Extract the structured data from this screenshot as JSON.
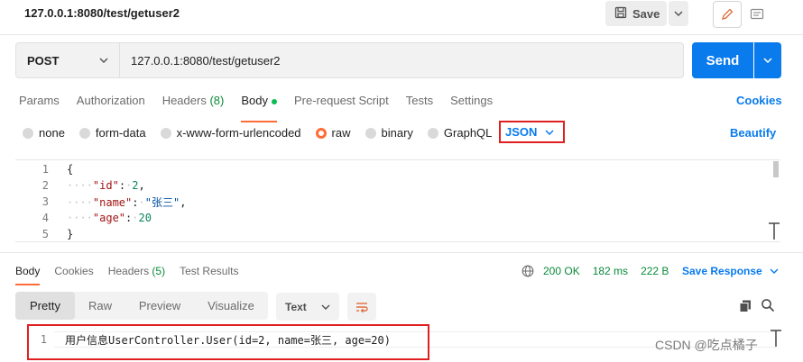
{
  "header": {
    "title": "127.0.0.1:8080/test/getuser2",
    "save_label": "Save"
  },
  "request": {
    "method": "POST",
    "url": "127.0.0.1:8080/test/getuser2",
    "send_label": "Send"
  },
  "tabs": {
    "params": "Params",
    "authorization": "Authorization",
    "headers": "Headers",
    "headers_count": "(8)",
    "body": "Body",
    "prerequest": "Pre-request Script",
    "tests": "Tests",
    "settings": "Settings",
    "cookies": "Cookies"
  },
  "body_types": {
    "none": "none",
    "form_data": "form-data",
    "urlencoded": "x-www-form-urlencoded",
    "raw": "raw",
    "binary": "binary",
    "graphql": "GraphQL",
    "selected": "raw",
    "language": "JSON",
    "beautify": "Beautify"
  },
  "editor": {
    "line_numbers": [
      "1",
      "2",
      "3",
      "4",
      "5"
    ],
    "open_brace": "{",
    "close_brace": "}",
    "indent": "····",
    "key_id": "\"id\"",
    "val_id": "2",
    "key_name": "\"name\"",
    "val_name": "\"张三\"",
    "key_age": "\"age\"",
    "val_age": "20",
    "colon": ":",
    "sep": "·",
    "comma": ","
  },
  "response_tabs": {
    "body": "Body",
    "cookies": "Cookies",
    "headers": "Headers",
    "headers_count": "(5)",
    "test_results": "Test Results"
  },
  "response_meta": {
    "status": "200 OK",
    "time": "182 ms",
    "size": "222 B",
    "save_response": "Save Response"
  },
  "view": {
    "pretty": "Pretty",
    "raw": "Raw",
    "preview": "Preview",
    "visualize": "Visualize",
    "format": "Text"
  },
  "response_body": {
    "line_number": "1",
    "text": "用户信息UserController.User(id=2, name=张三, age=20)"
  },
  "watermark": "CSDN @吃点橘子",
  "colors": {
    "accent_orange": "#ff6c37",
    "send_blue": "#097bed",
    "status_green": "#0a8a3a",
    "highlight_red": "#e02020"
  }
}
